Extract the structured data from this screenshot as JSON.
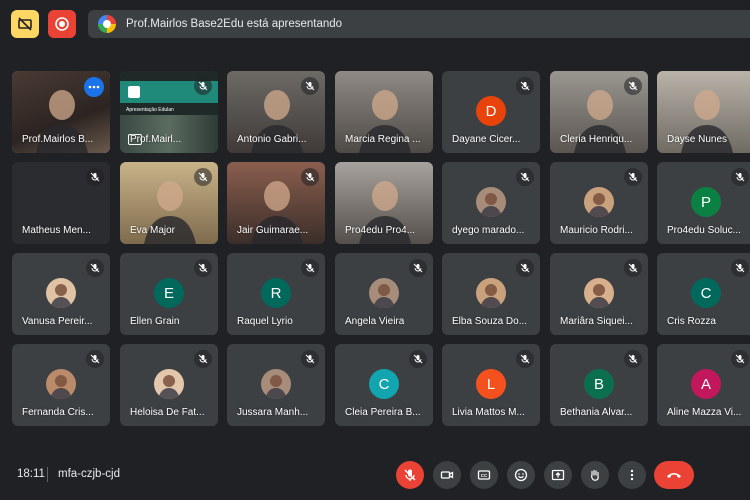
{
  "presenting": {
    "text": "Prof.Mairlos Base2Edu está apresentando"
  },
  "meeting": {
    "time": "18:11",
    "code": "mfa-czjb-cjd"
  },
  "colors": {
    "accent": "#8ab4f8",
    "end_call": "#ea4335",
    "hand_raise": "#fdd663"
  },
  "participants": [
    {
      "name": "Prof.Mairlos B...",
      "kind": "video",
      "active": true,
      "muted": false
    },
    {
      "name": "Prof.Mairl...",
      "kind": "presentation",
      "muted": true,
      "presentation_title": "Apresentação Edulan"
    },
    {
      "name": "Antonio Gabri...",
      "kind": "video",
      "muted": true
    },
    {
      "name": "Marcia Regina ...",
      "kind": "video",
      "muted": false
    },
    {
      "name": "Dayane Cicer...",
      "kind": "avatar",
      "initial": "D",
      "color": "#e8430a",
      "muted": true
    },
    {
      "name": "Cleria Henriqu...",
      "kind": "video",
      "muted": true
    },
    {
      "name": "Dayse Nunes",
      "kind": "video",
      "muted": false
    },
    {
      "name": "Matheus Men...",
      "kind": "dark",
      "muted": true
    },
    {
      "name": "Eva Major",
      "kind": "video",
      "muted": true
    },
    {
      "name": "Jair Guimarae...",
      "kind": "video",
      "muted": true
    },
    {
      "name": "Pro4edu Pro4...",
      "kind": "video",
      "muted": false
    },
    {
      "name": "dyego marado...",
      "kind": "photo",
      "muted": true
    },
    {
      "name": "Mauricio Rodri...",
      "kind": "photo",
      "muted": true
    },
    {
      "name": "Pro4edu Soluc...",
      "kind": "avatar",
      "initial": "P",
      "color": "#0b8043",
      "muted": true
    },
    {
      "name": "Vanusa Pereir...",
      "kind": "photo",
      "muted": true
    },
    {
      "name": "Ellen Grain",
      "kind": "avatar",
      "initial": "E",
      "color": "#00695c",
      "muted": true
    },
    {
      "name": "Raquel Lyrio",
      "kind": "avatar",
      "initial": "R",
      "color": "#00695c",
      "muted": true
    },
    {
      "name": "Angela Vieira",
      "kind": "photo",
      "muted": true
    },
    {
      "name": "Elba Souza Do...",
      "kind": "photo",
      "muted": true
    },
    {
      "name": "Mariâra Siquei...",
      "kind": "photo",
      "muted": true
    },
    {
      "name": "Cris Rozza",
      "kind": "avatar",
      "initial": "C",
      "color": "#00695c",
      "muted": true
    },
    {
      "name": "Fernanda Cris...",
      "kind": "photo",
      "muted": true
    },
    {
      "name": "Heloisa De Fat...",
      "kind": "photo",
      "muted": true
    },
    {
      "name": "Jussara Manh...",
      "kind": "photo",
      "muted": true
    },
    {
      "name": "Cleia Pereira B...",
      "kind": "avatar",
      "initial": "C",
      "color": "#12a4af",
      "muted": true
    },
    {
      "name": "Livia Mattos M...",
      "kind": "avatar",
      "initial": "L",
      "color": "#f4511e",
      "muted": true
    },
    {
      "name": "Bethania Alvar...",
      "kind": "avatar",
      "initial": "B",
      "color": "#0b6e4f",
      "muted": true
    },
    {
      "name": "Aline Mazza Vi...",
      "kind": "avatar",
      "initial": "A",
      "color": "#c2185b",
      "muted": true
    }
  ],
  "controls": [
    {
      "id": "mic",
      "icon": "mic-off-icon"
    },
    {
      "id": "camera",
      "icon": "camera-icon"
    },
    {
      "id": "captions",
      "icon": "captions-icon"
    },
    {
      "id": "emoji",
      "icon": "emoji-icon"
    },
    {
      "id": "present",
      "icon": "present-screen-icon"
    },
    {
      "id": "raise-hand",
      "icon": "raise-hand-icon"
    },
    {
      "id": "more",
      "icon": "more-options-icon"
    },
    {
      "id": "end-call",
      "icon": "end-call-icon"
    }
  ]
}
